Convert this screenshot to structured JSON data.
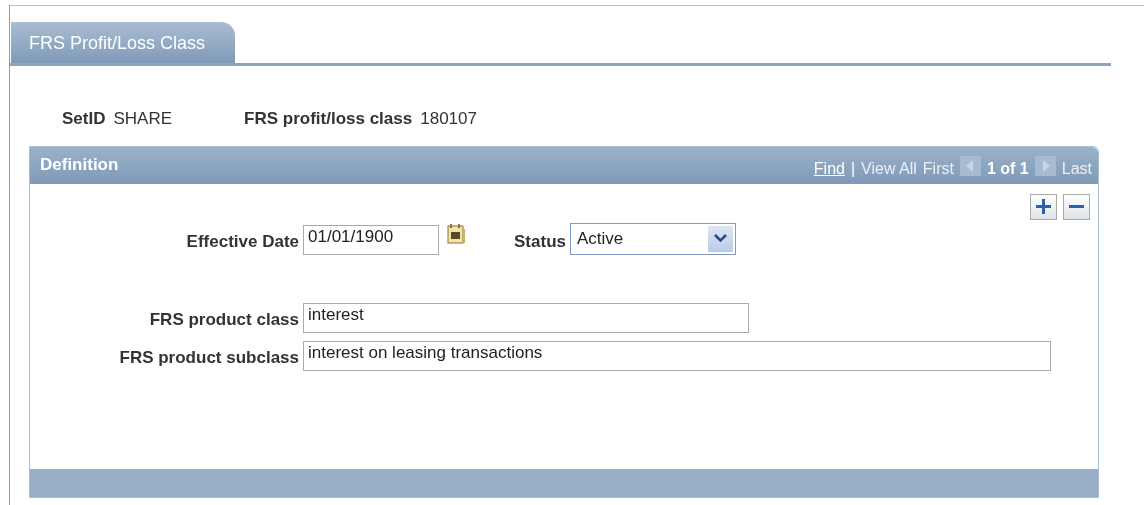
{
  "tabs": [
    {
      "label": "FRS Profit/Loss Class",
      "selected": true
    }
  ],
  "header_fields": [
    {
      "label": "SetID",
      "value": "SHARE"
    },
    {
      "label": "FRS profit/loss class",
      "value": "180107"
    }
  ],
  "panel": {
    "title": "Definition",
    "nav": [
      {
        "kind": "link",
        "text": "Find",
        "disabled": false
      },
      {
        "kind": "separator",
        "text": "|"
      },
      {
        "kind": "link",
        "text": "View All",
        "disabled": true
      },
      {
        "kind": "link",
        "text": "First",
        "disabled": true
      },
      {
        "kind": "prev",
        "disabled": true
      },
      {
        "kind": "count",
        "text": "1 of 1"
      },
      {
        "kind": "next",
        "disabled": true
      },
      {
        "kind": "link",
        "text": "Last",
        "disabled": true
      }
    ],
    "effective_date": {
      "label": "Effective Date",
      "value": "01/01/1900"
    },
    "status": {
      "label": "Status",
      "value": "Active"
    },
    "fields": [
      {
        "label": "FRS product class",
        "value": "interest"
      },
      {
        "label": "FRS product subclass",
        "value": "interest on leasing transactions"
      }
    ]
  }
}
